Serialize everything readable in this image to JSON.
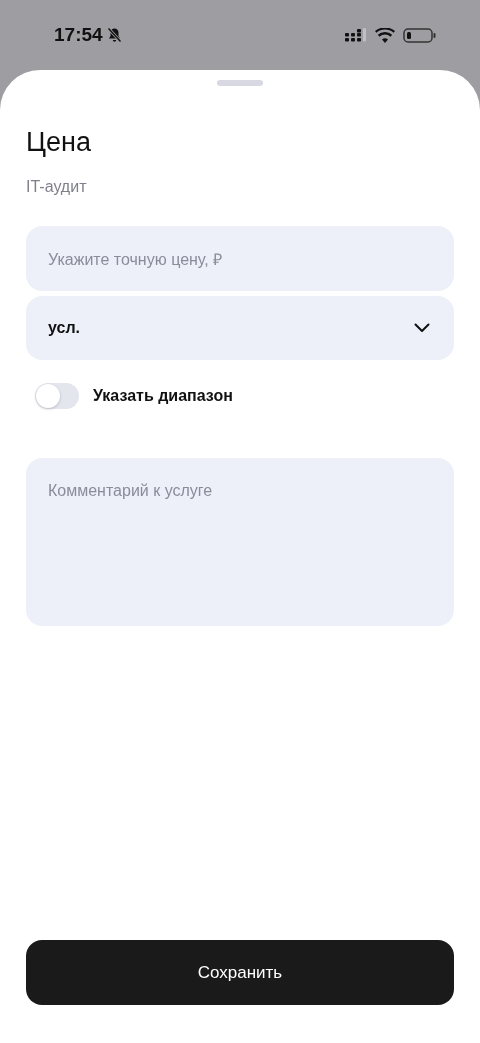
{
  "status_bar": {
    "time": "17:54"
  },
  "sheet": {
    "title": "Цена",
    "subtitle": "IT-аудит"
  },
  "price_field": {
    "placeholder": "Укажите точную цену, ₽"
  },
  "unit_select": {
    "value": "усл."
  },
  "range_toggle": {
    "label": "Указать диапазон",
    "on": false
  },
  "comment_field": {
    "placeholder": "Комментарий к услуге"
  },
  "save_button": {
    "label": "Сохранить"
  }
}
